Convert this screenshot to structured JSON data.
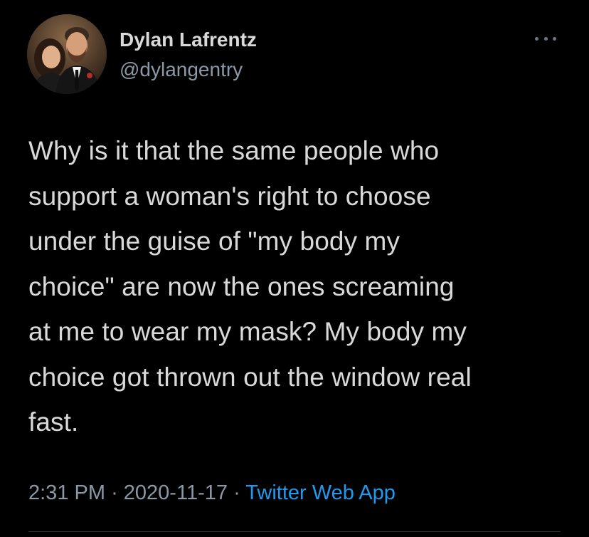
{
  "author": {
    "display_name": "Dylan Lafrentz",
    "handle": "@dylangentry"
  },
  "tweet": {
    "lines": [
      "Why is it that the same people who",
      "support a woman's right to choose",
      "under the guise of \"my body my",
      "choice\" are now the ones screaming",
      "at me to wear my mask? My body my",
      "choice got thrown out the window real",
      "fast."
    ]
  },
  "meta": {
    "time": "2:31 PM",
    "separator": "·",
    "date": "2020-11-17",
    "source": "Twitter Web App"
  },
  "icons": {
    "more": "more-horizontal-icon"
  },
  "colors": {
    "background": "#000000",
    "text": "#d9d9d9",
    "secondary": "#8b98a5",
    "link": "#1d9bf0"
  }
}
